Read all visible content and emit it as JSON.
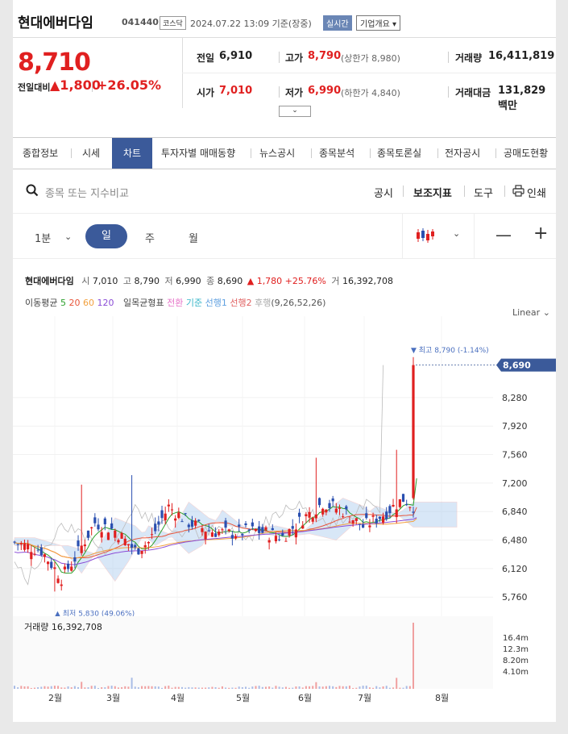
{
  "header": {
    "name": "현대에버다임",
    "code": "041440",
    "market": "코스닥",
    "datetime": "2024.07.22 13:09 기준(장중)",
    "realtime": "실시간",
    "corp_overview": "기업개요 ▾"
  },
  "price": {
    "current": "8,710",
    "change_label": "전일대비",
    "change": "▲1,800",
    "change_pct": "+26.05%",
    "up_color": "#e02020"
  },
  "quote": {
    "prev_label": "전일",
    "prev": "6,910",
    "open_label": "시가",
    "open": "7,010",
    "high_label": "고가",
    "high": "8,790",
    "upper_limit": "(상한가 8,980)",
    "low_label": "저가",
    "low": "6,990",
    "lower_limit": "(하한가 4,840)",
    "volume_label": "거래량",
    "volume": "16,411,819",
    "amount_label": "거래대금",
    "amount": "131,829 백만"
  },
  "tabs": [
    "종합정보",
    "시세",
    "차트",
    "투자자별 매매동향",
    "뉴스공시",
    "종목분석",
    "종목토론실",
    "전자공시",
    "공매도현황"
  ],
  "active_tab": "차트",
  "toolbar": {
    "search_placeholder": "종목 또는 지수비교",
    "disclosure": "공시",
    "indicator": "보조지표",
    "tools": "도구",
    "print": "인쇄"
  },
  "periods": [
    "1분",
    "일",
    "주",
    "월"
  ],
  "chart_info": {
    "name": "현대에버다임",
    "open_lbl": "시",
    "open": "7,010",
    "high_lbl": "고",
    "high": "8,790",
    "low_lbl": "저",
    "low": "6,990",
    "close_lbl": "종",
    "close": "8,690",
    "change": "▲ 1,780 +25.76%",
    "vol_lbl": "거",
    "volume": "16,392,708",
    "ma_label": "이동평균",
    "ma": [
      {
        "name": "5",
        "color": "#2ca02c"
      },
      {
        "name": "20",
        "color": "#e8553a"
      },
      {
        "name": "60",
        "color": "#f2a03d"
      },
      {
        "name": "120",
        "color": "#8a4cd6"
      }
    ],
    "ichimoku_label": "일목균형표",
    "ichimoku": [
      {
        "name": "전환",
        "color": "#e673c8"
      },
      {
        "name": "기준",
        "color": "#38b6c9"
      },
      {
        "name": "선행1",
        "color": "#5fa0e0"
      },
      {
        "name": "선행2",
        "color": "#e06060"
      },
      {
        "name": "후행",
        "color": "#aaaaaa"
      }
    ],
    "ichimoku_params": "(9,26,52,26)",
    "scale": "Linear"
  },
  "chart_data": {
    "type": "candlestick",
    "price_axis": [
      8280,
      7920,
      7560,
      7200,
      6840,
      6480,
      6120,
      5760
    ],
    "price_range": [
      5640,
      8900
    ],
    "current_price_tag": "8,690",
    "max_label": "▼ 최고 8,790 (-1.14%)",
    "min_label": "▲ 최저 5,830 (49.06%)",
    "x_labels": [
      "2월",
      "3월",
      "4월",
      "5월",
      "6월",
      "7월",
      "8월"
    ],
    "volume_label": "거래량",
    "volume_value": "16,392,708",
    "volume_axis": [
      "16.4m",
      "12.3m",
      "8.20m",
      "4.10m"
    ],
    "volume_max": 16400000,
    "candle_up_color": "#e02020",
    "candle_down_color": "#2a4fb0",
    "last_candle": {
      "open": 7010,
      "high": 8790,
      "low": 6990,
      "close": 8690,
      "volume": 16392708
    }
  }
}
